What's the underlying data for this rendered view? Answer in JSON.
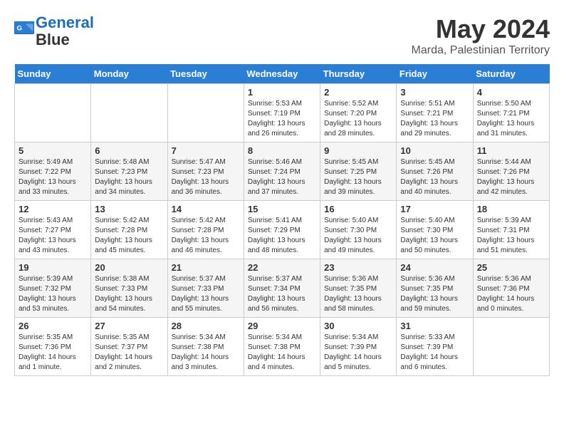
{
  "logo": {
    "line1": "General",
    "line2": "Blue"
  },
  "title": "May 2024",
  "location": "Marda, Palestinian Territory",
  "weekdays": [
    "Sunday",
    "Monday",
    "Tuesday",
    "Wednesday",
    "Thursday",
    "Friday",
    "Saturday"
  ],
  "weeks": [
    [
      {
        "day": "",
        "info": ""
      },
      {
        "day": "",
        "info": ""
      },
      {
        "day": "",
        "info": ""
      },
      {
        "day": "1",
        "info": "Sunrise: 5:53 AM\nSunset: 7:19 PM\nDaylight: 13 hours\nand 26 minutes."
      },
      {
        "day": "2",
        "info": "Sunrise: 5:52 AM\nSunset: 7:20 PM\nDaylight: 13 hours\nand 28 minutes."
      },
      {
        "day": "3",
        "info": "Sunrise: 5:51 AM\nSunset: 7:21 PM\nDaylight: 13 hours\nand 29 minutes."
      },
      {
        "day": "4",
        "info": "Sunrise: 5:50 AM\nSunset: 7:21 PM\nDaylight: 13 hours\nand 31 minutes."
      }
    ],
    [
      {
        "day": "5",
        "info": "Sunrise: 5:49 AM\nSunset: 7:22 PM\nDaylight: 13 hours\nand 33 minutes."
      },
      {
        "day": "6",
        "info": "Sunrise: 5:48 AM\nSunset: 7:23 PM\nDaylight: 13 hours\nand 34 minutes."
      },
      {
        "day": "7",
        "info": "Sunrise: 5:47 AM\nSunset: 7:23 PM\nDaylight: 13 hours\nand 36 minutes."
      },
      {
        "day": "8",
        "info": "Sunrise: 5:46 AM\nSunset: 7:24 PM\nDaylight: 13 hours\nand 37 minutes."
      },
      {
        "day": "9",
        "info": "Sunrise: 5:45 AM\nSunset: 7:25 PM\nDaylight: 13 hours\nand 39 minutes."
      },
      {
        "day": "10",
        "info": "Sunrise: 5:45 AM\nSunset: 7:26 PM\nDaylight: 13 hours\nand 40 minutes."
      },
      {
        "day": "11",
        "info": "Sunrise: 5:44 AM\nSunset: 7:26 PM\nDaylight: 13 hours\nand 42 minutes."
      }
    ],
    [
      {
        "day": "12",
        "info": "Sunrise: 5:43 AM\nSunset: 7:27 PM\nDaylight: 13 hours\nand 43 minutes."
      },
      {
        "day": "13",
        "info": "Sunrise: 5:42 AM\nSunset: 7:28 PM\nDaylight: 13 hours\nand 45 minutes."
      },
      {
        "day": "14",
        "info": "Sunrise: 5:42 AM\nSunset: 7:28 PM\nDaylight: 13 hours\nand 46 minutes."
      },
      {
        "day": "15",
        "info": "Sunrise: 5:41 AM\nSunset: 7:29 PM\nDaylight: 13 hours\nand 48 minutes."
      },
      {
        "day": "16",
        "info": "Sunrise: 5:40 AM\nSunset: 7:30 PM\nDaylight: 13 hours\nand 49 minutes."
      },
      {
        "day": "17",
        "info": "Sunrise: 5:40 AM\nSunset: 7:30 PM\nDaylight: 13 hours\nand 50 minutes."
      },
      {
        "day": "18",
        "info": "Sunrise: 5:39 AM\nSunset: 7:31 PM\nDaylight: 13 hours\nand 51 minutes."
      }
    ],
    [
      {
        "day": "19",
        "info": "Sunrise: 5:39 AM\nSunset: 7:32 PM\nDaylight: 13 hours\nand 53 minutes."
      },
      {
        "day": "20",
        "info": "Sunrise: 5:38 AM\nSunset: 7:33 PM\nDaylight: 13 hours\nand 54 minutes."
      },
      {
        "day": "21",
        "info": "Sunrise: 5:37 AM\nSunset: 7:33 PM\nDaylight: 13 hours\nand 55 minutes."
      },
      {
        "day": "22",
        "info": "Sunrise: 5:37 AM\nSunset: 7:34 PM\nDaylight: 13 hours\nand 56 minutes."
      },
      {
        "day": "23",
        "info": "Sunrise: 5:36 AM\nSunset: 7:35 PM\nDaylight: 13 hours\nand 58 minutes."
      },
      {
        "day": "24",
        "info": "Sunrise: 5:36 AM\nSunset: 7:35 PM\nDaylight: 13 hours\nand 59 minutes."
      },
      {
        "day": "25",
        "info": "Sunrise: 5:36 AM\nSunset: 7:36 PM\nDaylight: 14 hours\nand 0 minutes."
      }
    ],
    [
      {
        "day": "26",
        "info": "Sunrise: 5:35 AM\nSunset: 7:36 PM\nDaylight: 14 hours\nand 1 minute."
      },
      {
        "day": "27",
        "info": "Sunrise: 5:35 AM\nSunset: 7:37 PM\nDaylight: 14 hours\nand 2 minutes."
      },
      {
        "day": "28",
        "info": "Sunrise: 5:34 AM\nSunset: 7:38 PM\nDaylight: 14 hours\nand 3 minutes."
      },
      {
        "day": "29",
        "info": "Sunrise: 5:34 AM\nSunset: 7:38 PM\nDaylight: 14 hours\nand 4 minutes."
      },
      {
        "day": "30",
        "info": "Sunrise: 5:34 AM\nSunset: 7:39 PM\nDaylight: 14 hours\nand 5 minutes."
      },
      {
        "day": "31",
        "info": "Sunrise: 5:33 AM\nSunset: 7:39 PM\nDaylight: 14 hours\nand 6 minutes."
      },
      {
        "day": "",
        "info": ""
      }
    ]
  ]
}
